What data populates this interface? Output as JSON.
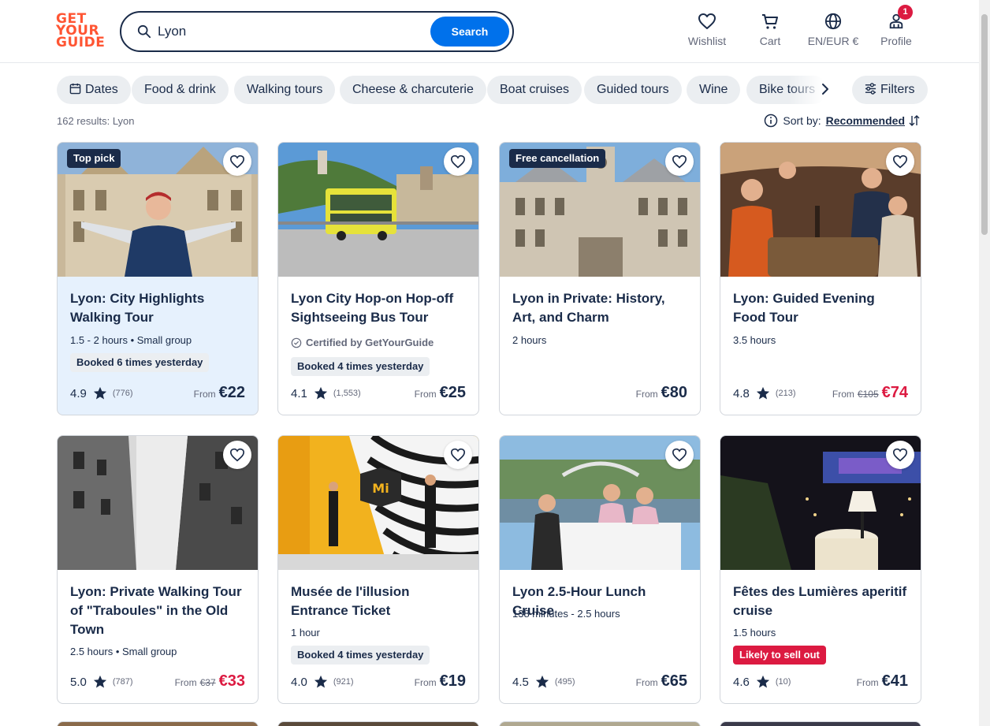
{
  "brand": {
    "logo_lines": [
      "GET",
      "YOUR",
      "GUIDE"
    ],
    "accent": "#ff5533",
    "primary": "#0071eb",
    "sale": "#dc1a41"
  },
  "search": {
    "value": "Lyon",
    "button_label": "Search",
    "icon": "search-icon"
  },
  "nav": {
    "wishlist": {
      "label": "Wishlist",
      "icon": "heart-icon"
    },
    "cart": {
      "label": "Cart",
      "icon": "cart-icon"
    },
    "locale": {
      "label": "EN/EUR €",
      "icon": "globe-icon"
    },
    "profile": {
      "label": "Profile",
      "icon": "user-icon",
      "badge": "1"
    }
  },
  "chips": [
    {
      "label": "Dates",
      "icon": "calendar-icon"
    },
    {
      "label": "Food & drink"
    },
    {
      "label": "Walking tours"
    },
    {
      "label": "Cheese & charcuterie"
    },
    {
      "label": "Boat cruises"
    },
    {
      "label": "Guided tours"
    },
    {
      "label": "Wine"
    },
    {
      "label": "Bike tours"
    }
  ],
  "filters_label": "Filters",
  "results_text": "162 results: Lyon",
  "sort": {
    "label": "Sort by:",
    "value": "Recommended"
  },
  "cards": [
    {
      "title": "Lyon: City Highlights Walking Tour",
      "tag": "Top pick",
      "meta": "1.5 - 2 hours • Small group",
      "pill": "Booked 6 times yesterday",
      "rating": "4.9",
      "reviews": "(776)",
      "from": "From",
      "price": "€22"
    },
    {
      "title": "Lyon City Hop-on Hop-off Sightseeing Bus Tour",
      "certified": "Certified by GetYourGuide",
      "pill": "Booked 4 times yesterday",
      "rating": "4.1",
      "reviews": "(1,553)",
      "from": "From",
      "price": "€25"
    },
    {
      "title": "Lyon in Private: History, Art, and Charm",
      "tag": "Free cancellation",
      "meta": "2 hours",
      "from": "From",
      "price": "€80"
    },
    {
      "title": "Lyon: Guided Evening Food Tour",
      "meta": "3.5 hours",
      "rating": "4.8",
      "reviews": "(213)",
      "from": "From",
      "old_price": "€105",
      "price": "€74"
    },
    {
      "title": "Lyon: Private Walking Tour of \"Traboules\" in the Old Town",
      "meta": "2.5 hours • Small group",
      "rating": "5.0",
      "reviews": "(787)",
      "from": "From",
      "old_price": "€37",
      "price": "€33"
    },
    {
      "title": "Musée de l'illusion Entrance Ticket",
      "meta": "1 hour",
      "pill": "Booked 4 times yesterday",
      "rating": "4.0",
      "reviews": "(921)",
      "from": "From",
      "price": "€19"
    },
    {
      "title": "Lyon 2.5-Hour Lunch Cruise",
      "meta": "138 minutes - 2.5 hours",
      "rating": "4.5",
      "reviews": "(495)",
      "from": "From",
      "price": "€65"
    },
    {
      "title": "Fêtes des Lumières aperitif cruise",
      "meta": "1.5 hours",
      "pill_alert": "Likely to sell out",
      "rating": "4.6",
      "reviews": "(10)",
      "from": "From",
      "price": "€41"
    }
  ]
}
